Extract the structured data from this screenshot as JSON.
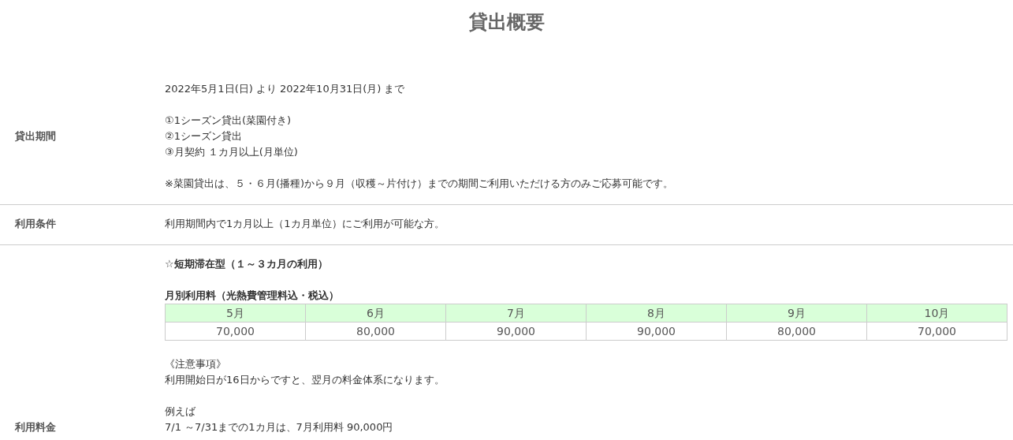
{
  "title": "貸出概要",
  "rows": [
    {
      "label": "貸出期間",
      "blocks": [
        {
          "kind": "text",
          "lines": [
            "2022年5月1日(日) より 2022年10月31日(月) まで"
          ]
        },
        {
          "kind": "text",
          "lines": [
            "①1シーズン貸出(菜園付き)",
            "②1シーズン貸出",
            "③月契約 １カ月以上(月単位)"
          ]
        },
        {
          "kind": "text",
          "lines": [
            "※菜園貸出は、５・６月(播種)から９月（収穫～片付け）までの期間ご利用いただける方のみご応募可能です。"
          ]
        }
      ]
    },
    {
      "label": "利用条件",
      "blocks": [
        {
          "kind": "text",
          "lines": [
            "利用期間内で1カ月以上（1カ月単位）にご利用が可能な方。"
          ]
        }
      ]
    },
    {
      "label": "利用料金",
      "blocks": [
        {
          "kind": "heading",
          "text": "☆短期滞在型（１～３カ月の利用）"
        },
        {
          "kind": "table",
          "caption": "月別利用料（光熱費管理料込・税込）",
          "columns": [
            "5月",
            "6月",
            "7月",
            "8月",
            "9月",
            "10月"
          ],
          "values": [
            "70,000",
            "80,000",
            "90,000",
            "90,000",
            "80,000",
            "70,000"
          ]
        },
        {
          "kind": "text",
          "lines": [
            "《注意事項》",
            "利用開始日が16日からですと、翌月の料金体系になります。"
          ]
        },
        {
          "kind": "text",
          "lines": [
            "例えば",
            "7/1 ～7/31までの1カ月は、7月利用料 90,000円"
          ]
        }
      ]
    }
  ]
}
